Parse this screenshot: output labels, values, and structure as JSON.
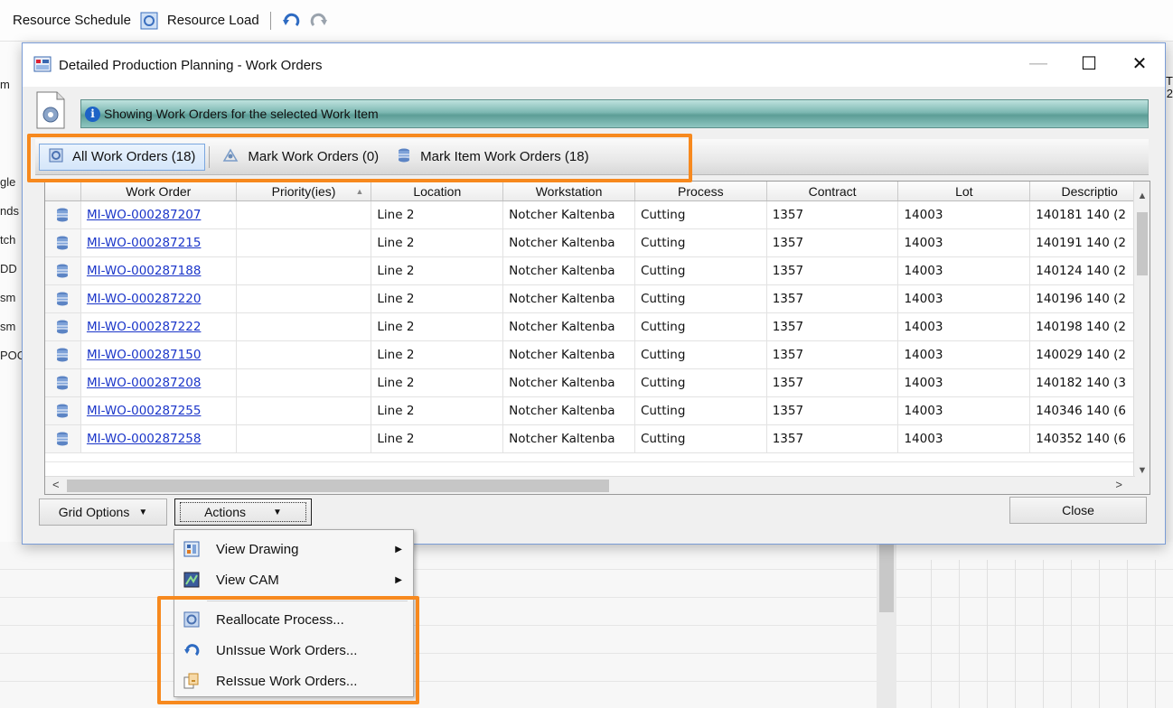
{
  "background_app": {
    "toolbar": {
      "resource_schedule": "Resource Schedule",
      "resource_load": "Resource Load"
    },
    "left_fragments": [
      "m",
      "gle",
      "nds",
      "tch",
      "DD",
      "sm",
      "sm",
      "POC"
    ],
    "right_fragments": [
      "T",
      "2"
    ]
  },
  "dialog": {
    "title": "Detailed Production Planning - Work Orders",
    "info_banner": "Showing Work Orders for the selected Work Item",
    "tabs": [
      {
        "label": "All Work Orders (18)",
        "icon": "all-orders-icon",
        "active": true
      },
      {
        "label": "Mark Work Orders (0)",
        "icon": "mark-icon",
        "active": false
      },
      {
        "label": "Mark Item Work Orders (18)",
        "icon": "database-icon",
        "active": false
      }
    ],
    "grid": {
      "columns": [
        "Work Order",
        "Priority(ies)",
        "Location",
        "Workstation",
        "Process",
        "Contract",
        "Lot",
        "Descriptio"
      ],
      "rows": [
        {
          "work_order": "MI-WO-000287207",
          "priority": "",
          "location": "Line 2",
          "workstation": "Notcher Kaltenba",
          "process": "Cutting",
          "contract": "1357",
          "lot": "14003",
          "description": "140181 140 (2"
        },
        {
          "work_order": "MI-WO-000287215",
          "priority": "",
          "location": "Line 2",
          "workstation": "Notcher Kaltenba",
          "process": "Cutting",
          "contract": "1357",
          "lot": "14003",
          "description": "140191 140 (2"
        },
        {
          "work_order": "MI-WO-000287188",
          "priority": "",
          "location": "Line 2",
          "workstation": "Notcher Kaltenba",
          "process": "Cutting",
          "contract": "1357",
          "lot": "14003",
          "description": "140124 140 (2"
        },
        {
          "work_order": "MI-WO-000287220",
          "priority": "",
          "location": "Line 2",
          "workstation": "Notcher Kaltenba",
          "process": "Cutting",
          "contract": "1357",
          "lot": "14003",
          "description": "140196 140 (2"
        },
        {
          "work_order": "MI-WO-000287222",
          "priority": "",
          "location": "Line 2",
          "workstation": "Notcher Kaltenba",
          "process": "Cutting",
          "contract": "1357",
          "lot": "14003",
          "description": "140198 140 (2"
        },
        {
          "work_order": "MI-WO-000287150",
          "priority": "",
          "location": "Line 2",
          "workstation": "Notcher Kaltenba",
          "process": "Cutting",
          "contract": "1357",
          "lot": "14003",
          "description": "140029 140 (2"
        },
        {
          "work_order": "MI-WO-000287208",
          "priority": "",
          "location": "Line 2",
          "workstation": "Notcher Kaltenba",
          "process": "Cutting",
          "contract": "1357",
          "lot": "14003",
          "description": "140182 140 (3"
        },
        {
          "work_order": "MI-WO-000287255",
          "priority": "",
          "location": "Line 2",
          "workstation": "Notcher Kaltenba",
          "process": "Cutting",
          "contract": "1357",
          "lot": "14003",
          "description": "140346 140 (6"
        },
        {
          "work_order": "MI-WO-000287258",
          "priority": "",
          "location": "Line 2",
          "workstation": "Notcher Kaltenba",
          "process": "Cutting",
          "contract": "1357",
          "lot": "14003",
          "description": "140352 140 (6"
        }
      ]
    },
    "footer": {
      "grid_options": "Grid Options",
      "actions": "Actions",
      "close": "Close"
    }
  },
  "actions_menu": [
    {
      "label": "View Drawing",
      "icon": "view-drawing-icon",
      "submenu": true
    },
    {
      "label": "View CAM",
      "icon": "view-cam-icon",
      "submenu": true
    },
    {
      "label": "Reallocate Process...",
      "icon": "reallocate-icon",
      "submenu": false
    },
    {
      "label": "UnIssue Work Orders...",
      "icon": "unissue-icon",
      "submenu": false
    },
    {
      "label": "ReIssue Work Orders...",
      "icon": "reissue-icon",
      "submenu": false
    }
  ],
  "colors": {
    "highlight": "#f7891e",
    "link": "#1a35c9",
    "banner": "#7cb8b2"
  }
}
